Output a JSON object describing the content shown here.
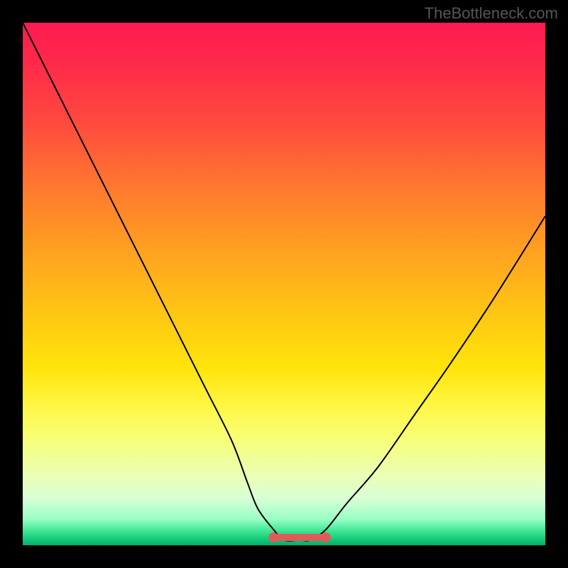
{
  "watermark": "TheBottleneck.com",
  "chart_data": {
    "type": "line",
    "title": "",
    "xlabel": "",
    "ylabel": "",
    "x": [
      0,
      5,
      10,
      15,
      20,
      25,
      30,
      35,
      40,
      43,
      45,
      48,
      50,
      53,
      55,
      58,
      62,
      68,
      75,
      82,
      90,
      100
    ],
    "values": [
      100,
      90,
      80,
      70,
      60,
      50,
      40,
      30,
      20,
      12,
      7,
      3,
      1,
      1,
      1,
      3,
      8,
      15,
      25,
      35,
      47,
      63
    ],
    "xlim": [
      0,
      100
    ],
    "ylim": [
      0,
      100
    ],
    "flat_segment": {
      "x_start": 48,
      "x_end": 58,
      "y": 1.5
    },
    "background_gradient": {
      "stops": [
        {
          "pos": 0,
          "color": "#ff1a52"
        },
        {
          "pos": 50,
          "color": "#ffc414"
        },
        {
          "pos": 75,
          "color": "#fff84a"
        },
        {
          "pos": 100,
          "color": "#00b066"
        }
      ]
    }
  }
}
